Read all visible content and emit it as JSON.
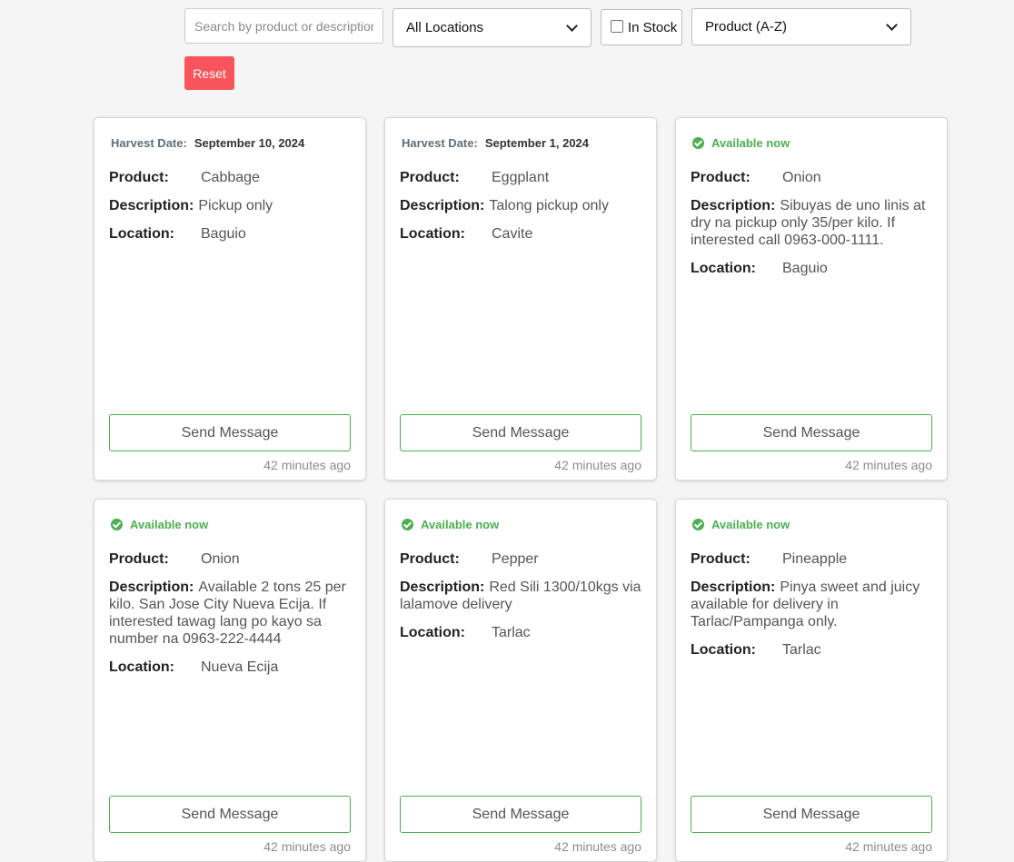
{
  "filters": {
    "search_placeholder": "Search by product or description",
    "location_selected": "All Locations",
    "in_stock_label": "In Stock",
    "in_stock_checked": false,
    "sort_selected": "Product (A-Z)",
    "reset_label": "Reset"
  },
  "labels": {
    "harvest_date": "Harvest Date:",
    "available_now": "Available now",
    "product": "Product:",
    "description": "Description:",
    "location": "Location:",
    "send_message": "Send Message"
  },
  "colors": {
    "accent_green": "#4caf50",
    "reset_red": "#f7545b"
  },
  "listings": [
    {
      "status": "harvest",
      "harvest_date": "September 10, 2024",
      "product": "Cabbage",
      "description": "Pickup only",
      "location": "Baguio",
      "time_ago": "42 minutes ago"
    },
    {
      "status": "harvest",
      "harvest_date": "September 1, 2024",
      "product": "Eggplant",
      "description": "Talong pickup only",
      "location": "Cavite",
      "time_ago": "42 minutes ago"
    },
    {
      "status": "available",
      "product": "Onion",
      "description": "Sibuyas de uno linis at dry na pickup only 35/per kilo. If interested call 0963-000-1111.",
      "location": "Baguio",
      "time_ago": "42 minutes ago"
    },
    {
      "status": "available",
      "product": "Onion",
      "description": "Available 2 tons 25 per kilo. San Jose City Nueva Ecija. If interested tawag lang po kayo sa number na 0963-222-4444",
      "location": "Nueva Ecija",
      "time_ago": "42 minutes ago"
    },
    {
      "status": "available",
      "product": "Pepper",
      "description": "Red Sili 1300/10kgs via lalamove delivery",
      "location": "Tarlac",
      "time_ago": "42 minutes ago"
    },
    {
      "status": "available",
      "product": "Pineapple",
      "description": "Pinya sweet and juicy available for delivery in Tarlac/Pampanga only.",
      "location": "Tarlac",
      "time_ago": "42 minutes ago"
    }
  ]
}
